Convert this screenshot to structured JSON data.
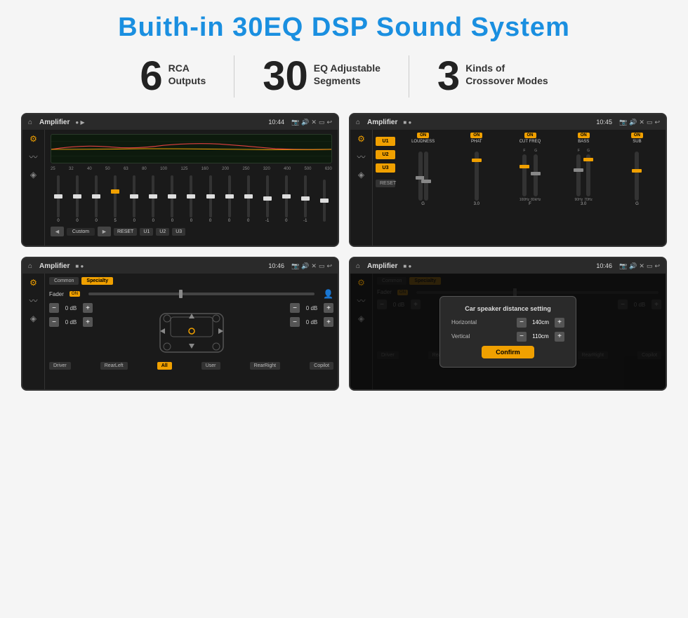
{
  "title": "Buith-in 30EQ DSP Sound System",
  "stats": [
    {
      "number": "6",
      "label": "RCA\nOutputs"
    },
    {
      "number": "30",
      "label": "EQ Adjustable\nSegments"
    },
    {
      "number": "3",
      "label": "Kinds of\nCrossover Modes"
    }
  ],
  "screens": {
    "eq_screen": {
      "topbar_title": "Amplifier",
      "time": "10:44",
      "frequencies": [
        "25",
        "32",
        "40",
        "50",
        "63",
        "80",
        "100",
        "125",
        "160",
        "200",
        "250",
        "320",
        "400",
        "500",
        "630"
      ],
      "values": [
        "0",
        "0",
        "0",
        "5",
        "0",
        "0",
        "0",
        "0",
        "0",
        "0",
        "0",
        "-1",
        "0",
        "-1"
      ],
      "custom_label": "Custom",
      "reset_label": "RESET",
      "presets": [
        "U1",
        "U2",
        "U3"
      ]
    },
    "crossover_screen": {
      "topbar_title": "Amplifier",
      "time": "10:45",
      "presets": [
        "U1",
        "U2",
        "U3"
      ],
      "channels": [
        "LOUDNESS",
        "PHAT",
        "CUT FREQ",
        "BASS",
        "SUB"
      ],
      "reset_label": "RESET"
    },
    "fader_screen": {
      "topbar_title": "Amplifier",
      "time": "10:46",
      "tabs": [
        "Common",
        "Specialty"
      ],
      "fader_label": "Fader",
      "fader_on": "ON",
      "volumes": [
        "0 dB",
        "0 dB",
        "0 dB",
        "0 dB"
      ],
      "buttons": [
        "Driver",
        "RearLeft",
        "All",
        "User",
        "RearRight",
        "Copilot"
      ]
    },
    "dialog_screen": {
      "topbar_title": "Amplifier",
      "time": "10:46",
      "tabs": [
        "Common",
        "Specialty"
      ],
      "dialog_title": "Car speaker distance setting",
      "horizontal_label": "Horizontal",
      "horizontal_value": "140cm",
      "vertical_label": "Vertical",
      "vertical_value": "110cm",
      "confirm_label": "Confirm",
      "volumes": [
        "0 dB",
        "0 dB"
      ],
      "buttons": [
        "Driver",
        "RearLeft",
        "All",
        "User",
        "RearRight",
        "Copilot"
      ]
    }
  }
}
